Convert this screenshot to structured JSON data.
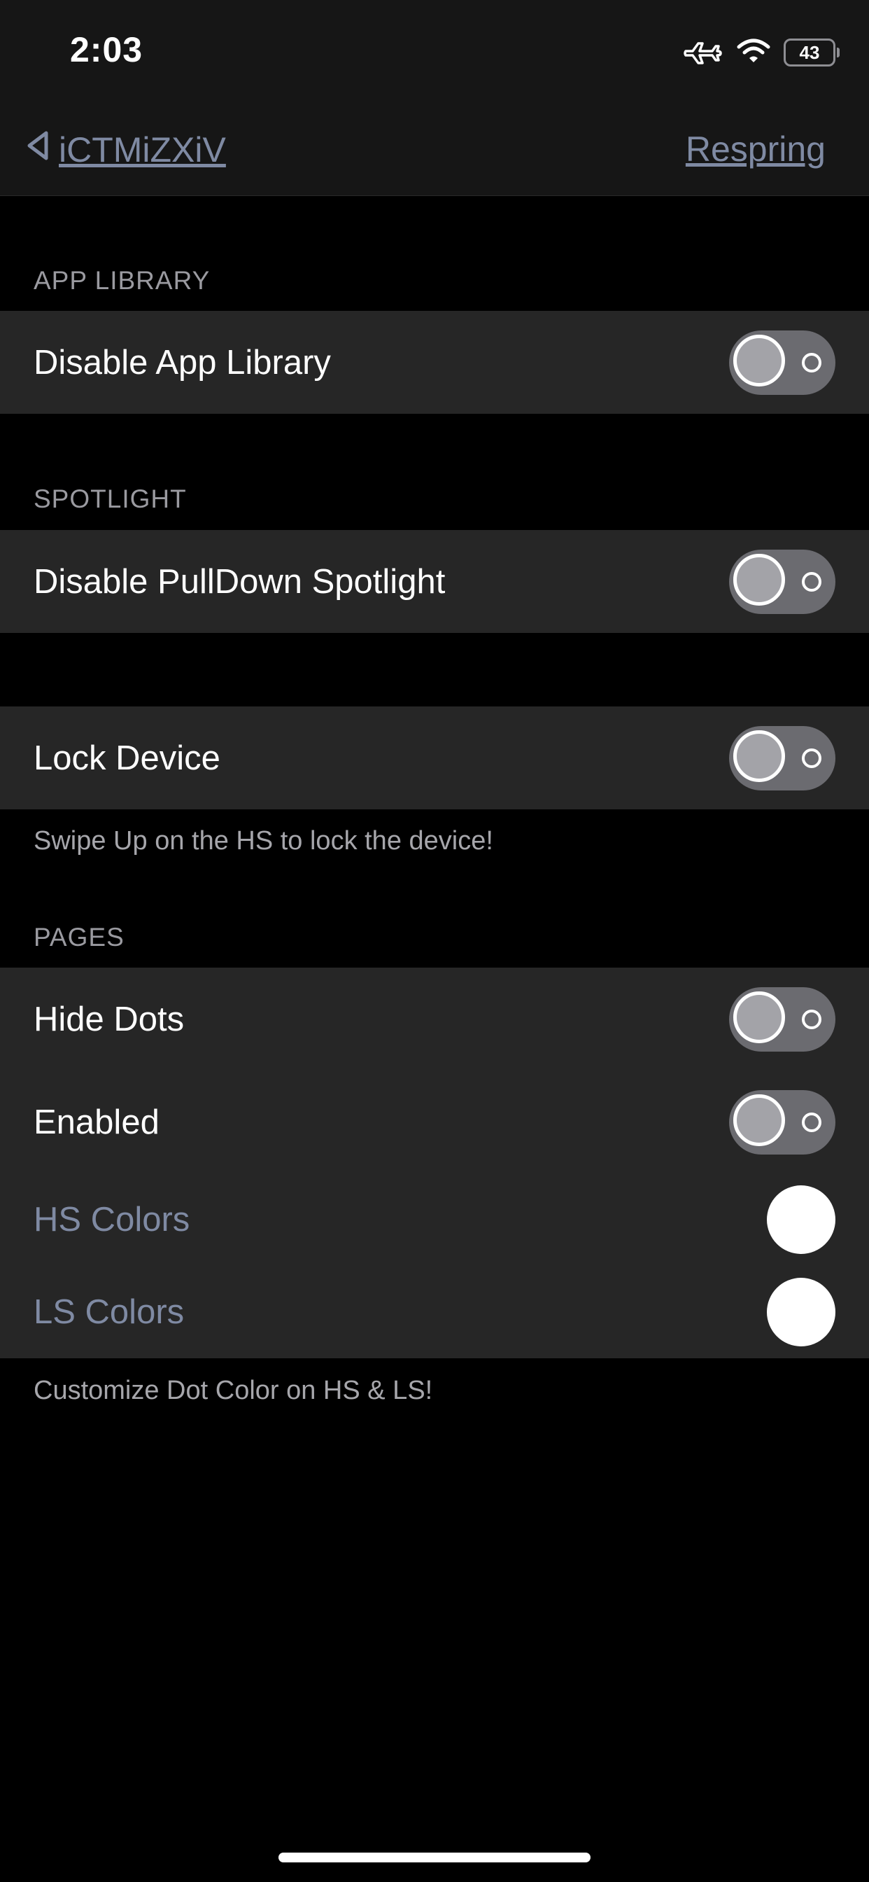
{
  "status_bar": {
    "time": "2:03",
    "battery": "43",
    "icons": [
      "airplane-icon",
      "wifi-icon",
      "battery-icon"
    ]
  },
  "nav": {
    "back_label": "iCTMiZXiV",
    "right_label": "Respring"
  },
  "sections": {
    "app_library": {
      "header": "APP LIBRARY",
      "rows": [
        {
          "label": "Disable App Library",
          "enabled": false
        }
      ]
    },
    "spotlight": {
      "header": "SPOTLIGHT",
      "rows": [
        {
          "label": "Disable PullDown Spotlight",
          "enabled": false
        }
      ]
    },
    "lock": {
      "rows": [
        {
          "label": "Lock Device",
          "enabled": false
        }
      ],
      "footer": "Swipe Up on the HS to lock the device!"
    },
    "pages": {
      "header": "PAGES",
      "rows": [
        {
          "label": "Hide Dots",
          "enabled": false
        },
        {
          "label": "Enabled",
          "enabled": false
        },
        {
          "label": "HS Colors",
          "color": "#FFFFFF"
        },
        {
          "label": "LS Colors",
          "color": "#FFFFFF"
        }
      ],
      "footer": "Customize Dot Color on HS & LS!"
    }
  },
  "colors": {
    "background": "#000000",
    "group_background": "#262626",
    "nav_background": "#161616",
    "link": "#7F8AA3",
    "header_text": "#9A9AA0",
    "toggle_track_off": "#6B6B70"
  }
}
